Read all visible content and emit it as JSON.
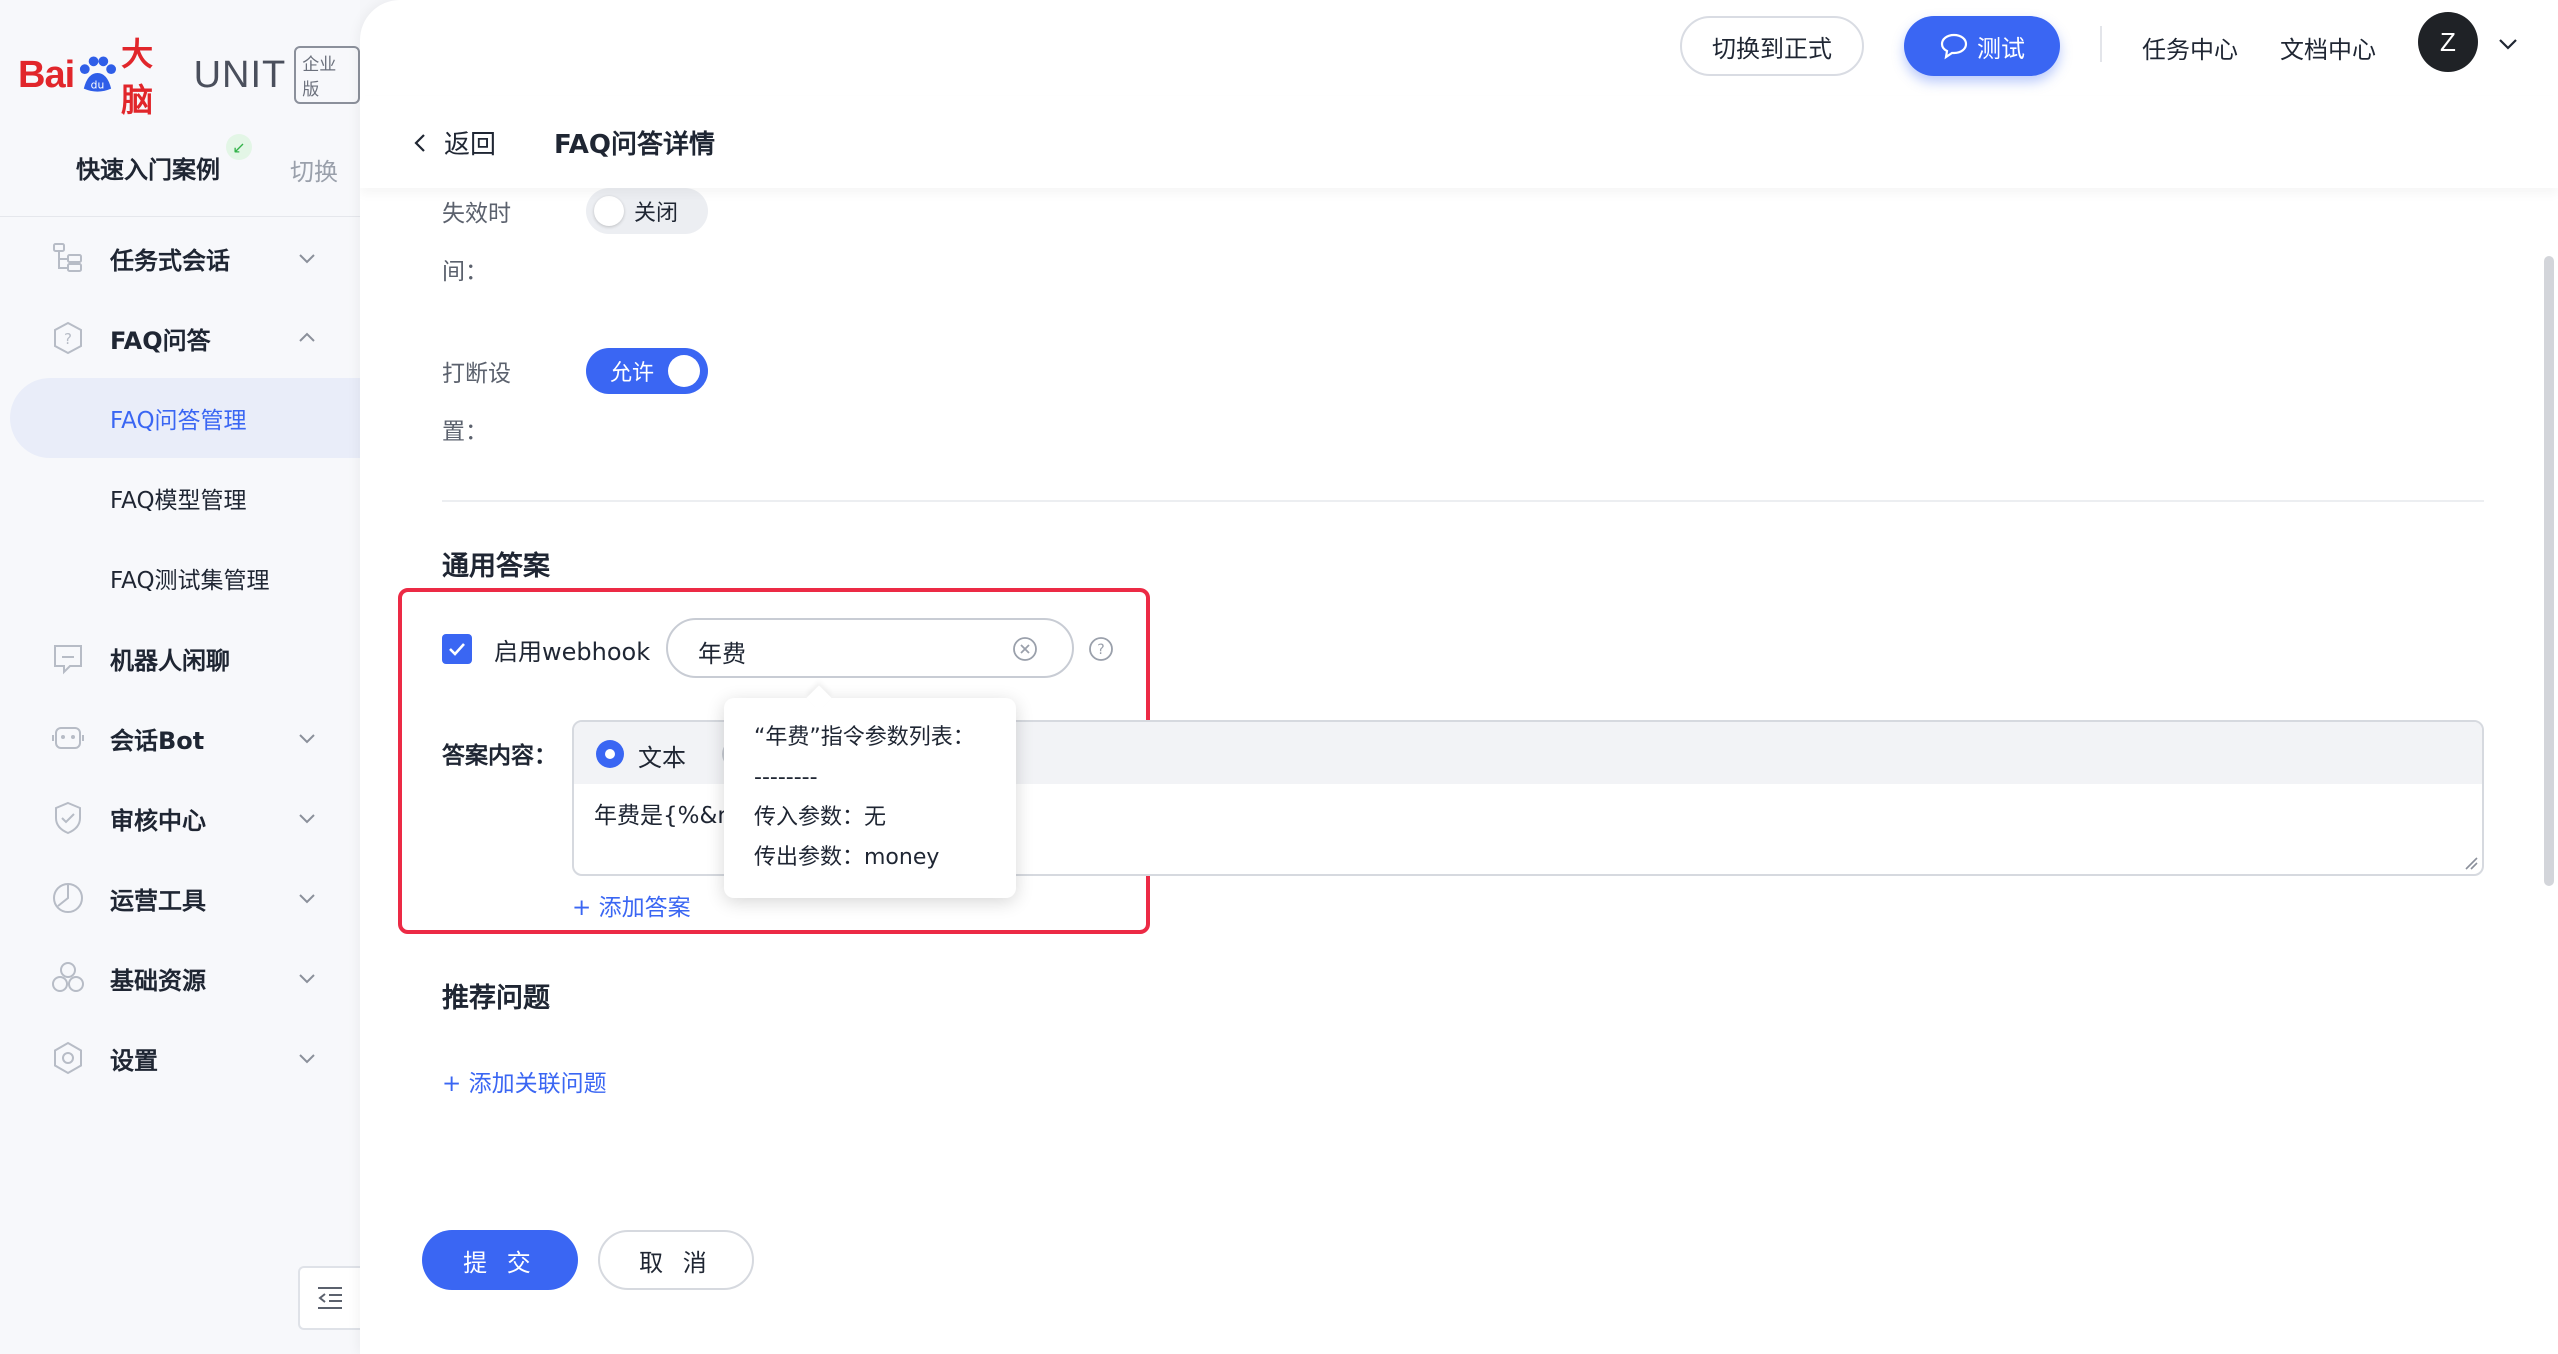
{
  "logo": {
    "bai": "Bai",
    "du": "du",
    "dn": "大脑",
    "unit": "UNIT",
    "edition": "企业版"
  },
  "sidebar": {
    "quick_start": "快速入门案例",
    "switch": "切换",
    "items": [
      {
        "label": "任务式会话",
        "icon": "tree-icon",
        "expanded": false
      },
      {
        "label": "FAQ问答",
        "icon": "question-shield-icon",
        "expanded": true,
        "children": [
          {
            "label": "FAQ问答管理",
            "active": true
          },
          {
            "label": "FAQ模型管理",
            "active": false
          },
          {
            "label": "FAQ测试集管理",
            "active": false
          }
        ]
      },
      {
        "label": "机器人闲聊",
        "icon": "chat-icon",
        "expanded": null
      },
      {
        "label": "会话Bot",
        "icon": "bot-icon",
        "expanded": false
      },
      {
        "label": "审核中心",
        "icon": "shield-check-icon",
        "expanded": false
      },
      {
        "label": "运营工具",
        "icon": "gauge-icon",
        "expanded": false
      },
      {
        "label": "基础资源",
        "icon": "hexagons-icon",
        "expanded": false
      },
      {
        "label": "设置",
        "icon": "hex-gear-icon",
        "expanded": false
      }
    ]
  },
  "topbar": {
    "switch_formal": "切换到正式",
    "test": "测试",
    "task_center": "任务中心",
    "doc_center": "文档中心",
    "avatar_letter": "Z"
  },
  "breadcrumb": {
    "back": "返回",
    "title": "FAQ问答详情"
  },
  "form": {
    "expire_label_1": "失效时",
    "expire_label_2": "间：",
    "expire_toggle": "关闭",
    "interrupt_label_1": "打断设",
    "interrupt_label_2": "置：",
    "interrupt_toggle": "允许"
  },
  "general_answer": {
    "title": "通用答案",
    "webhook_label": "启用webhook",
    "webhook_enabled": true,
    "webhook_value": "年费",
    "answer_label": "答案内容：",
    "radio_text": "文本",
    "answer_text": "年费是{%&m",
    "add_answer": "+ 添加答案"
  },
  "tooltip": {
    "title": "“年费”指令参数列表：",
    "divider": "--------",
    "input_params": "传入参数：无",
    "output_params": "传出参数：money"
  },
  "recommend": {
    "title": "推荐问题",
    "add_related": "+ 添加关联问题"
  },
  "footer": {
    "submit": "提 交",
    "cancel": "取 消"
  },
  "colors": {
    "primary": "#3a66f3",
    "highlight": "#ec2a45",
    "brand_red": "#e1262b"
  }
}
